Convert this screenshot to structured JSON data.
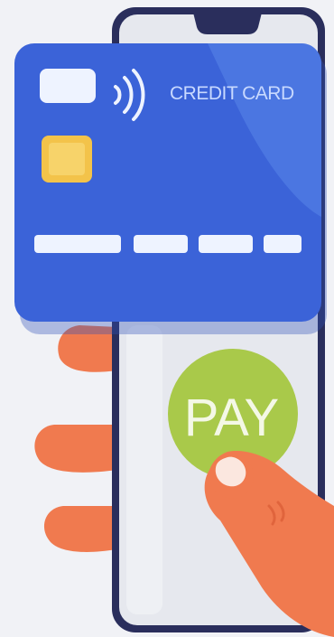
{
  "card": {
    "label": "CREDIT CARD",
    "contactless_icon": "contactless-icon",
    "chip_icon": "chip-icon",
    "color_main": "#3b63d8",
    "color_light": "#5a86ea",
    "chip_color": "#f3c34a",
    "label_color": "#c8d9ff"
  },
  "pay_button": {
    "label": "PAY",
    "color": "#a9c94a",
    "label_color": "#f4f8e6"
  },
  "phone": {
    "frame_color": "#2a2e5c",
    "screen_color": "#e6e8ee"
  },
  "hand": {
    "skin_color": "#f07a4f",
    "skin_dark_color": "#e0643c"
  }
}
